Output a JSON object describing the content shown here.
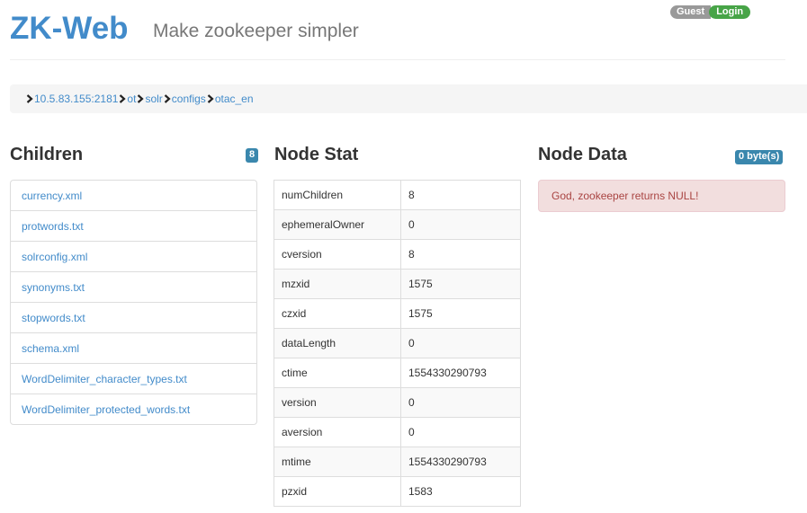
{
  "header": {
    "app_title": "ZK-Web",
    "subtitle": "Make zookeeper simpler",
    "user_label": "Guest",
    "login_label": "Login"
  },
  "breadcrumb": {
    "items": [
      "10.5.83.155:2181",
      "ot",
      "solr",
      "configs",
      "otac_en"
    ]
  },
  "children": {
    "title": "Children",
    "count": "8",
    "items": [
      "currency.xml",
      "protwords.txt",
      "solrconfig.xml",
      "synonyms.txt",
      "stopwords.txt",
      "schema.xml",
      "WordDelimiter_character_types.txt",
      "WordDelimiter_protected_words.txt"
    ]
  },
  "node_stat": {
    "title": "Node Stat",
    "rows": [
      {
        "key": "numChildren",
        "value": "8"
      },
      {
        "key": "ephemeralOwner",
        "value": "0"
      },
      {
        "key": "cversion",
        "value": "8"
      },
      {
        "key": "mzxid",
        "value": "1575"
      },
      {
        "key": "czxid",
        "value": "1575"
      },
      {
        "key": "dataLength",
        "value": "0"
      },
      {
        "key": "ctime",
        "value": "1554330290793"
      },
      {
        "key": "version",
        "value": "0"
      },
      {
        "key": "aversion",
        "value": "0"
      },
      {
        "key": "mtime",
        "value": "1554330290793"
      },
      {
        "key": "pzxid",
        "value": "1583"
      }
    ]
  },
  "node_data": {
    "title": "Node Data",
    "size_badge": "0 byte(s)",
    "message": "God, zookeeper returns NULL!"
  },
  "colors": {
    "brand": "#428bca",
    "login": "#47a447",
    "badge": "#3a87ad",
    "alert_bg": "#f2dede",
    "alert_text": "#a94442"
  }
}
